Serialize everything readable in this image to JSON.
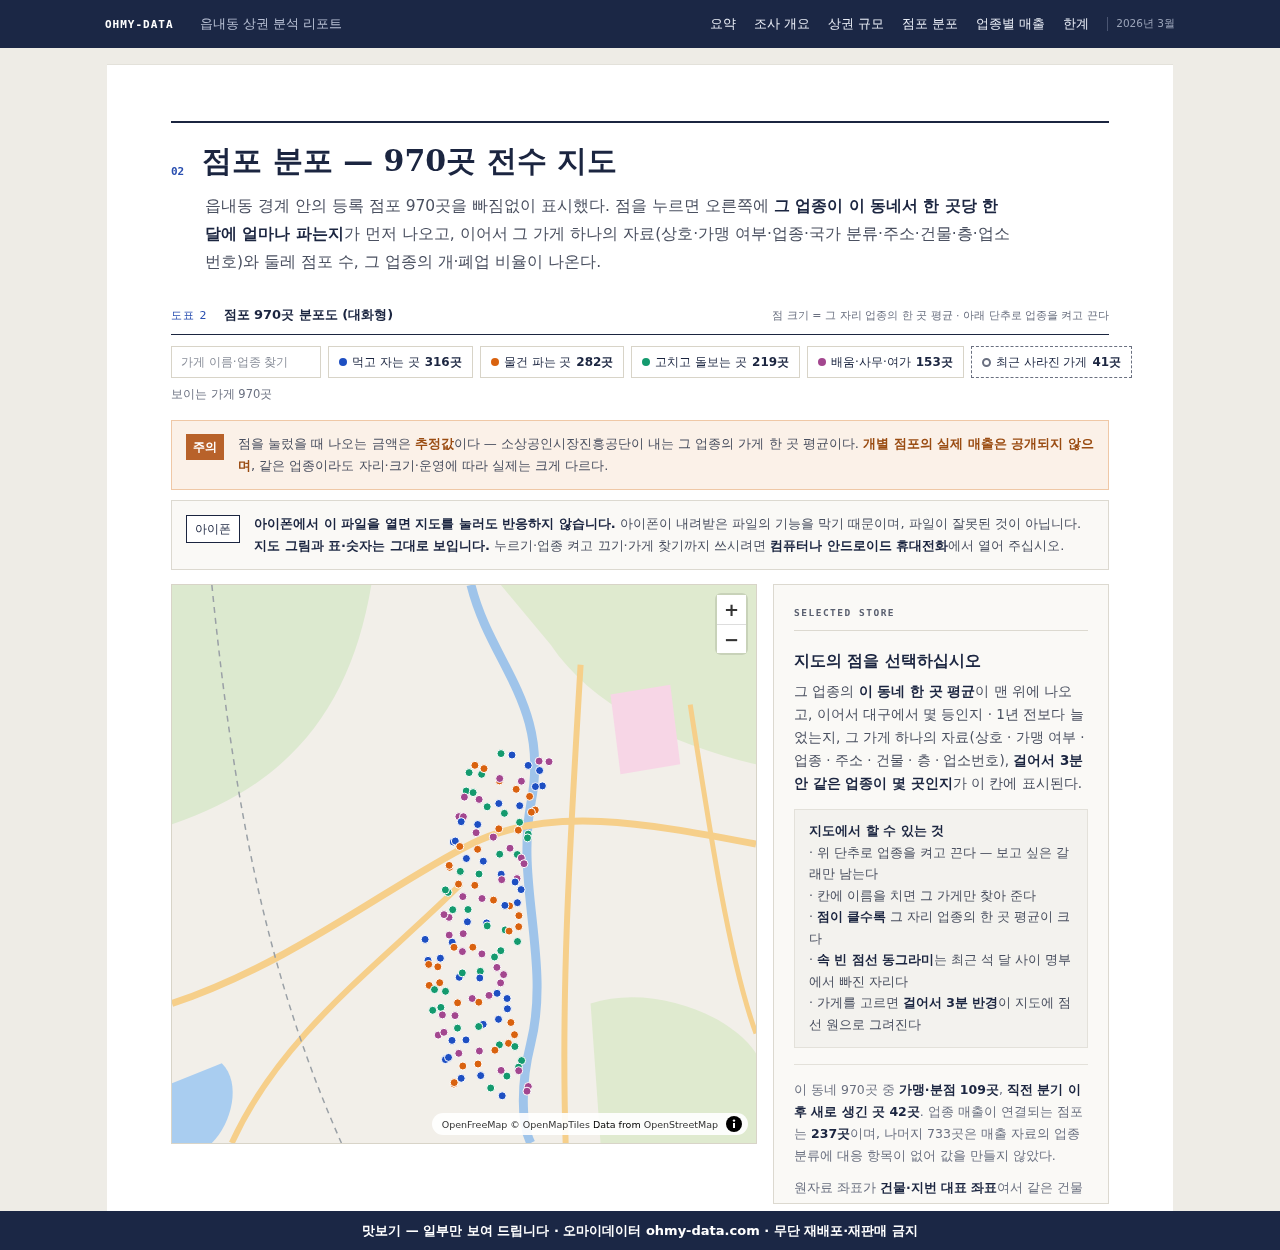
{
  "nav": {
    "brand": "OHMY-DATA",
    "report": "읍내동 상권 분석 리포트",
    "items": [
      {
        "label": "요약",
        "selected": false
      },
      {
        "label": "조사 개요",
        "selected": false
      },
      {
        "label": "상권 규모",
        "selected": false
      },
      {
        "label": "점포 분포",
        "selected": false
      },
      {
        "label": "업종별 매출",
        "selected": false
      },
      {
        "label": "한계",
        "selected": false
      }
    ],
    "date": "2026년 3월"
  },
  "section": {
    "number": "02",
    "title": "점포 분포 — 970곳 전수 지도",
    "intro": "읍내동 경계 안의 등록 점포 970곳을 빠짐없이 표시했다. 점을 누르면 오른쪽에 **그 업종이 이 동네서 한 곳당 한 달에 얼마나 파는지**가 먼저 나오고, 이어서 그 가게 하나의 자료(상호·가맹 여부·업종·국가 분류·주소·건물·층·업소번호)와 둘레 점포 수, 그 업종의 개·폐업 비율이 나온다."
  },
  "figure": {
    "label": "도표 2",
    "title": "점포 970곳 분포도 (대화형)",
    "note": "점 크기 = 그 자리 업종의 한 곳 평균 · 아래 단추로 업종을 켜고 끈다"
  },
  "search": {
    "placeholder": "가게 이름·업종 찾기"
  },
  "filters": [
    {
      "kind": "category",
      "label": "먹고 자는 곳",
      "count": "316곳",
      "color": "#1e4fc2"
    },
    {
      "kind": "category",
      "label": "물건 파는 곳",
      "count": "282곳",
      "color": "#d9620f"
    },
    {
      "kind": "category",
      "label": "고치고 돌보는 곳",
      "count": "219곳",
      "color": "#149a6e"
    },
    {
      "kind": "category",
      "label": "배움·사무·여가",
      "count": "153곳",
      "color": "#a3478f"
    },
    {
      "kind": "closed",
      "label": "최근 사라진 가게",
      "count": "41곳"
    }
  ],
  "visible_count": "보이는 가게 970곳",
  "notices": [
    {
      "kind": "caution",
      "badge": "주의",
      "text": "점을 눌렀을 때 나오는 금액은 **추정값**이다 — 소상공인시장진흥공단이 내는 그 업종의 가게 한 곳 평균이다. **개별 점포의 실제 매출은 공개되지 않으며**, 같은 업종이라도 자리·크기·운영에 따라 실제는 크게 다르다."
    },
    {
      "kind": "device",
      "badge": "아이폰",
      "text": "**아이폰에서 이 파일을 열면 지도를 눌러도 반응하지 않습니다.** 아이폰이 내려받은 파일의 기능을 막기 때문이며, 파일이 잘못된 것이 아닙니다. **지도 그림과 표·숫자는 그대로 보입니다.** 누르기·업종 켜고 끄기·가게 찾기까지 쓰시려면 **컴퓨터나 안드로이드 휴대전화**에서 열어 주십시오."
    }
  ],
  "map": {
    "kind": "picture",
    "zoom_in": "+",
    "zoom_out": "−",
    "attribution": "OpenFreeMap © OpenMapTiles **Data from** OpenStreetMap"
  },
  "panel": {
    "eyebrow": "SELECTED STORE",
    "title": "지도의 점을 선택하십시오",
    "body": "그 업종의 **이 동네 한 곳 평균**이 맨 위에 나오고, 이어서 대구에서 몇 등인지 · 1년 전보다 늘었는지, 그 가게 하나의 자료(상호 · 가맹 여부 · 업종 · 주소 · 건물 · 층 · 업소번호), **걸어서 3분 안 같은 업종이 몇 곳인지**가 이 칸에 표시된다.",
    "tips": {
      "title": "지도에서 할 수 있는 것",
      "items": [
        "· 위 단추로 업종을 켜고 끈다 — 보고 싶은 갈래만 남는다",
        "· 칸에 이름을 치면 그 가게만 찾아 준다",
        "· **점이 클수록** 그 자리 업종의 한 곳 평균이 크다",
        "· **속 빈 점선 동그라미**는 최근 석 달 사이 명부에서 빠진 자리다",
        "· 가게를 고르면 **걸어서 3분 반경**이 지도에 점선 원으로 그려진다"
      ]
    },
    "notes": [
      "이 동네 970곳 중 **가맹·분점 109곳**, **직전 분기 이후 새로 생긴 곳 42곳**. 업종 매출이 연결되는 점포는 **237곳**이며, 나머지 733곳은 매출 자료의 업종 분류에 대응 항목이 없어 값을 만들지 않았다.",
      "원자료 좌표가 **건물·지번 대표 좌표**여서 같은 건물"
    ]
  },
  "footer": "맛보기 — 일부만 보여 드립니다 · 오마이데이터 ohmy-data.com · 무단 재배포·재판매 금지"
}
